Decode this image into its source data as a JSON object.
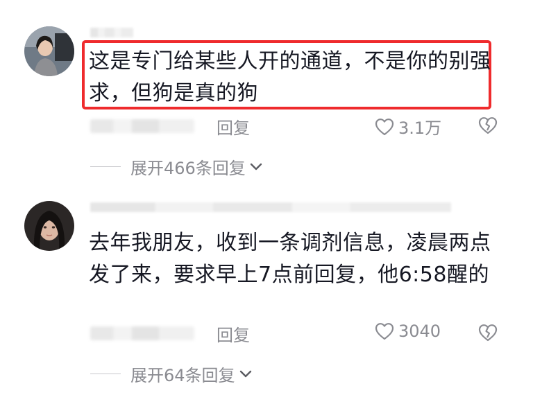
{
  "comments": [
    {
      "text": "这是专门给某些人开的通道，不是你的别强求，但狗是真的狗",
      "reply_label": "回复",
      "likes": "3.1万",
      "expand_label": "展开466条回复"
    },
    {
      "text": "去年我朋友，收到一条调剂信息，凌晨两点发了来，要求早上7点前回复，他6:58醒的",
      "reply_label": "回复",
      "likes": "3040",
      "expand_label": "展开64条回复"
    }
  ],
  "colors": {
    "highlight_border": "#ef2b2d",
    "secondary_text": "#8a8b91",
    "primary_text": "#161823"
  },
  "icons": {
    "like": "heart-outline-icon",
    "dislike": "broken-heart-icon",
    "expand": "chevron-down-icon"
  }
}
